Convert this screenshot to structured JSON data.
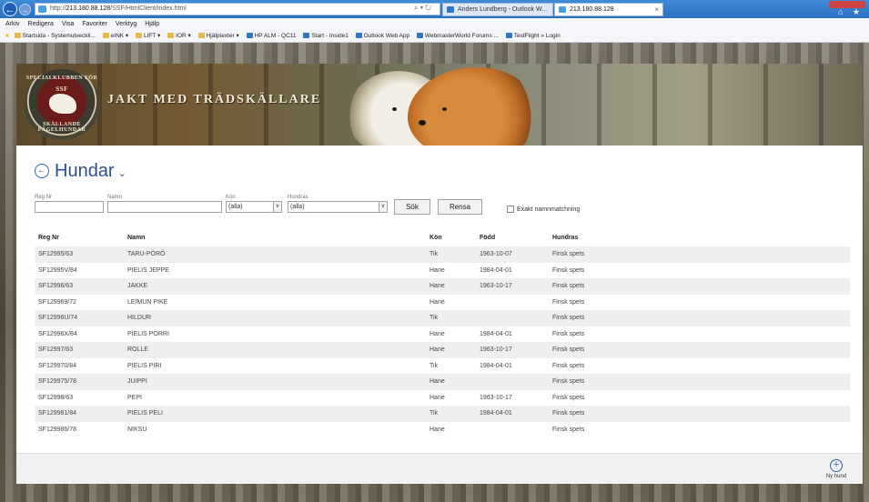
{
  "browser": {
    "address": "http://213.180.88.128/SSF/HtmlClient/index.html",
    "address_host": "213.180.88.128",
    "address_rest": "/SSF/HtmlClient/index.html",
    "address_tools": "⌕ ▾ ↻",
    "tabs": [
      {
        "label": "Anders Lundberg - Outlook W..."
      },
      {
        "label": "213.180.88.128"
      }
    ],
    "tab_close": "×",
    "right_icons": "⌂ ★"
  },
  "menu": [
    "Arkiv",
    "Redigera",
    "Visa",
    "Favoriter",
    "Verktyg",
    "Hjälp"
  ],
  "favorites": [
    "Startsida - Systemutveckli...",
    "eINK ▾",
    "LIFT ▾",
    "IOR ▾",
    "Hjälptexter ▾",
    "HP ALM - QC11",
    "Start - Inside1",
    "Outlook Web App",
    "WebmasterWorld Forums ...",
    "TestFlight » Login"
  ],
  "banner": {
    "logo_top": "SPECIALKLUBBEN FÖR",
    "logo_mid": "SSF",
    "logo_bottom": "SKÄLLANDE FÅGELHUNDAR",
    "title": "Jakt med trädskällare"
  },
  "page": {
    "title": "Hundar",
    "back_icon": "←",
    "title_chevron": "⌄"
  },
  "filters": {
    "regnr_label": "Reg Nr",
    "namn_label": "Namn",
    "kon_label": "Kön",
    "kon_value": "(alla)",
    "hundras_label": "Hundras",
    "hundras_value": "(alla)",
    "select_arrow": "∨",
    "search_button": "Sök",
    "clear_button": "Rensa",
    "exact_match_label": "Exakt namnmatchning"
  },
  "table": {
    "headers": {
      "regnr": "Reg Nr",
      "namn": "Namn",
      "kon": "Kön",
      "fodd": "Född",
      "hundras": "Hundras"
    },
    "rows": [
      {
        "regnr": "SF12995/63",
        "namn": "TARU-PÖRÖ",
        "kon": "Tik",
        "fodd": "1963-10-07",
        "hundras": "Finsk spets"
      },
      {
        "regnr": "SF12995V/84",
        "namn": "PIELIS JEPPE",
        "kon": "Hane",
        "fodd": "1984-04-01",
        "hundras": "Finsk spets"
      },
      {
        "regnr": "SF12996/63",
        "namn": "JAKKE",
        "kon": "Hane",
        "fodd": "1963-10-17",
        "hundras": "Finsk spets"
      },
      {
        "regnr": "SF129969/72",
        "namn": "LEIMUN PIKE",
        "kon": "Hane",
        "fodd": "",
        "hundras": "Finsk spets"
      },
      {
        "regnr": "SF12996U/74",
        "namn": "HILDUR",
        "kon": "Tik",
        "fodd": "",
        "hundras": "Finsk spets"
      },
      {
        "regnr": "SF12996X/84",
        "namn": "PIELIS PÖRRI",
        "kon": "Hane",
        "fodd": "1984-04-01",
        "hundras": "Finsk spets"
      },
      {
        "regnr": "SF12997/63",
        "namn": "ROLLE",
        "kon": "Hane",
        "fodd": "1963-10-17",
        "hundras": "Finsk spets"
      },
      {
        "regnr": "SF129970/84",
        "namn": "PIELIS PIRI",
        "kon": "Tik",
        "fodd": "1984-04-01",
        "hundras": "Finsk spets"
      },
      {
        "regnr": "SF129975/78",
        "namn": "JUIPPI",
        "kon": "Hane",
        "fodd": "",
        "hundras": "Finsk spets"
      },
      {
        "regnr": "SF12998/63",
        "namn": "PEPI",
        "kon": "Hane",
        "fodd": "1963-10-17",
        "hundras": "Finsk spets"
      },
      {
        "regnr": "SF129981/84",
        "namn": "PIELIS PELI",
        "kon": "Tik",
        "fodd": "1984-04-01",
        "hundras": "Finsk spets"
      },
      {
        "regnr": "SF129986/78",
        "namn": "NIKSU",
        "kon": "Hane",
        "fodd": "",
        "hundras": "Finsk spets"
      }
    ]
  },
  "bottom": {
    "new_icon": "+",
    "new_label": "Ny hund"
  }
}
